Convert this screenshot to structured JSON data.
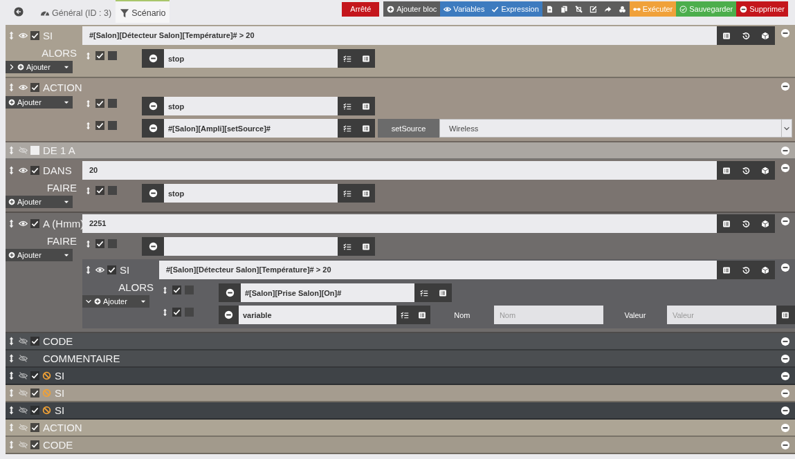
{
  "toolbar": {
    "tabs": [
      {
        "label": "Général (ID : 3)",
        "selected": false
      },
      {
        "label": "Scénario",
        "selected": true
      }
    ],
    "status": "Arrêté",
    "buttons": [
      {
        "kind": "text",
        "label": "Ajouter bloc"
      },
      {
        "kind": "text",
        "label": "Variables"
      },
      {
        "kind": "text",
        "label": "Expression"
      },
      {
        "kind": "icon"
      },
      {
        "kind": "icon"
      },
      {
        "kind": "icon"
      },
      {
        "kind": "icon"
      },
      {
        "kind": "icon"
      },
      {
        "kind": "icon"
      },
      {
        "kind": "text",
        "label": "Exécuter"
      },
      {
        "kind": "text",
        "label": "Sauvegarder"
      },
      {
        "kind": "text",
        "label": "Supprimer"
      }
    ]
  },
  "blocks": [
    {
      "type": "SI",
      "color": "#a9a091",
      "visible": true,
      "enabled": true,
      "blocked": false,
      "field": "#[Salon][Détecteur Salon][Température]# > 20",
      "sublabel": "ALORS",
      "add": {
        "label": "Ajouter",
        "expanded": false
      },
      "actions": [
        {
          "kind": "action",
          "enabled": true,
          "parallel": false,
          "value": "stop"
        }
      ]
    },
    {
      "type": "ACTION",
      "color": "#9e9388",
      "visible": true,
      "enabled": true,
      "blocked": false,
      "add": {
        "label": "Ajouter"
      },
      "actions": [
        {
          "kind": "action",
          "enabled": true,
          "parallel": false,
          "value": "stop"
        },
        {
          "kind": "action",
          "enabled": true,
          "parallel": false,
          "value": "#[Salon][Ampli][setSource]#",
          "option": {
            "label": "setSource",
            "value": "Wireless"
          }
        }
      ]
    },
    {
      "type": "DE 1 A",
      "color": "#aba7a2",
      "visible": false,
      "enabled": false,
      "blocked": false
    },
    {
      "type": "DANS",
      "color": "#7b7470",
      "visible": true,
      "enabled": true,
      "blocked": false,
      "field": "20",
      "sublabel": "FAIRE",
      "add": {
        "label": "Ajouter"
      },
      "actions": [
        {
          "kind": "action",
          "enabled": true,
          "parallel": false,
          "value": "stop"
        }
      ]
    },
    {
      "type": "A (Hmm)",
      "color": "#6f6c6b",
      "visible": true,
      "enabled": true,
      "blocked": false,
      "field": "2251",
      "sublabel": "FAIRE",
      "add": {
        "label": "Ajouter"
      },
      "actions": [
        {
          "kind": "action",
          "enabled": true,
          "parallel": false
        },
        {
          "kind": "block",
          "block": {
            "type": "SI",
            "color": "#5f5f62",
            "visible": true,
            "enabled": true,
            "blocked": false,
            "field": "#[Salon][Détecteur Salon][Température]# > 20",
            "sublabel": "ALORS",
            "add": {
              "label": "Ajouter",
              "expanded": true
            },
            "actions": [
              {
                "kind": "action",
                "enabled": true,
                "parallel": false,
                "value": "#[Salon][Prise Salon][On]#"
              },
              {
                "kind": "action",
                "enabled": true,
                "parallel": false,
                "value": "variable",
                "params": [
                  {
                    "label": "Nom",
                    "placeholder": "Nom"
                  },
                  {
                    "label": "Valeur",
                    "placeholder": "Valeur"
                  }
                ]
              }
            ]
          }
        }
      ]
    },
    {
      "type": "CODE",
      "color": "#4f5255",
      "visible": false,
      "enabled": true,
      "blocked": false
    },
    {
      "type": "COMMENTAIRE",
      "color": "#4b4e51",
      "visible": false,
      "blocked": false
    },
    {
      "type": "SI",
      "color": "#3f4347",
      "visible": false,
      "enabled": true,
      "blocked": true
    },
    {
      "type": "SI",
      "color": "#a59c8f",
      "visible": false,
      "enabled": true,
      "blocked": true
    },
    {
      "type": "SI",
      "color": "#3f4347",
      "visible": false,
      "enabled": true,
      "blocked": true
    },
    {
      "type": "ACTION",
      "color": "#ada595",
      "visible": false,
      "enabled": true,
      "blocked": false
    },
    {
      "type": "CODE",
      "color": "#a29a8c",
      "visible": false,
      "enabled": true,
      "blocked": false
    }
  ]
}
